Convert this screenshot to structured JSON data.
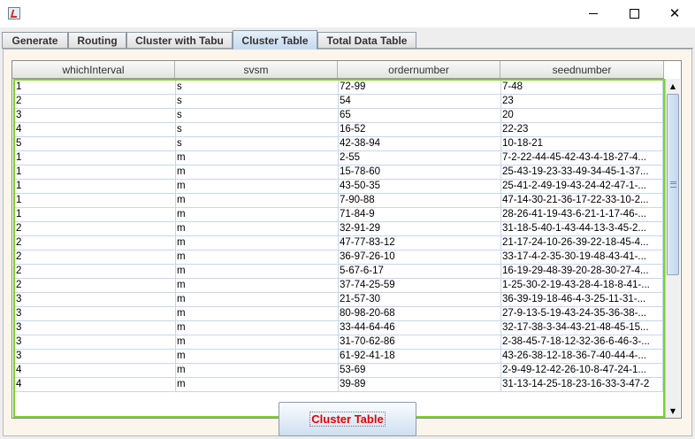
{
  "window": {
    "icon": "java-app-icon"
  },
  "tabs": [
    {
      "label": "Generate",
      "active": false
    },
    {
      "label": "Routing",
      "active": false
    },
    {
      "label": "Cluster with Tabu",
      "active": false
    },
    {
      "label": "Cluster Table",
      "active": true
    },
    {
      "label": "Total Data Table",
      "active": false
    }
  ],
  "table": {
    "columns": [
      "whichInterval",
      "svsm",
      "ordernumber",
      "seednumber"
    ],
    "rows": [
      [
        "1",
        "s",
        "72-99",
        "7-48"
      ],
      [
        "2",
        "s",
        "54",
        "23"
      ],
      [
        "3",
        "s",
        "65",
        "20"
      ],
      [
        "4",
        "s",
        "16-52",
        "22-23"
      ],
      [
        "5",
        "s",
        "42-38-94",
        "10-18-21"
      ],
      [
        "1",
        "m",
        "2-55",
        "7-2-22-44-45-42-43-4-18-27-4..."
      ],
      [
        "1",
        "m",
        "15-78-60",
        "25-43-19-23-33-49-34-45-1-37..."
      ],
      [
        "1",
        "m",
        "43-50-35",
        "25-41-2-49-19-43-24-42-47-1-..."
      ],
      [
        "1",
        "m",
        "7-90-88",
        "47-14-30-21-36-17-22-33-10-2..."
      ],
      [
        "1",
        "m",
        "71-84-9",
        "28-26-41-19-43-6-21-1-17-46-..."
      ],
      [
        "2",
        "m",
        "32-91-29",
        "31-18-5-40-1-43-44-13-3-45-2..."
      ],
      [
        "2",
        "m",
        "47-77-83-12",
        "21-17-24-10-26-39-22-18-45-4..."
      ],
      [
        "2",
        "m",
        "36-97-26-10",
        "33-17-4-2-35-30-19-48-43-41-..."
      ],
      [
        "2",
        "m",
        "5-67-6-17",
        "16-19-29-48-39-20-28-30-27-4..."
      ],
      [
        "2",
        "m",
        "37-74-25-59",
        "1-25-30-2-19-43-28-4-18-8-41-..."
      ],
      [
        "3",
        "m",
        "21-57-30",
        "36-39-19-18-46-4-3-25-11-31-..."
      ],
      [
        "3",
        "m",
        "80-98-20-68",
        "27-9-13-5-19-43-24-35-36-38-..."
      ],
      [
        "3",
        "m",
        "33-44-64-46",
        "32-17-38-3-34-43-21-48-45-15..."
      ],
      [
        "3",
        "m",
        "31-70-62-86",
        "2-38-45-7-18-12-32-36-6-46-3-..."
      ],
      [
        "3",
        "m",
        "61-92-41-18",
        "43-26-38-12-18-36-7-40-44-4-..."
      ],
      [
        "4",
        "m",
        "53-69",
        "2-9-49-12-42-26-10-8-47-24-1..."
      ],
      [
        "4",
        "m",
        "39-89",
        "31-13-14-25-18-23-16-33-3-47-2"
      ]
    ]
  },
  "action_button": {
    "label": "Cluster Table",
    "label_color": "#e00000"
  },
  "colors": {
    "selection_border": "#7ed321",
    "panel_background": "#fbf5ec"
  }
}
